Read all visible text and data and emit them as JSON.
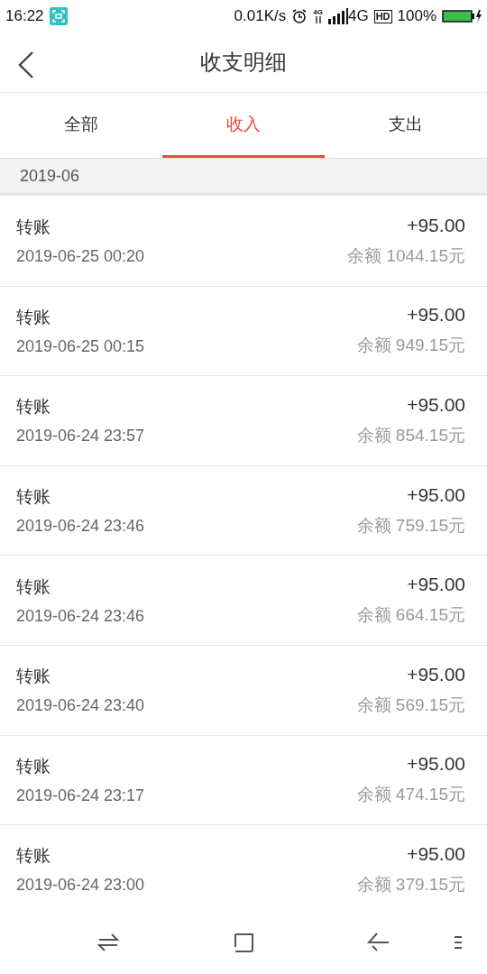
{
  "status_bar": {
    "time": "16:22",
    "network_speed": "0.01K/s",
    "data_label": "4G",
    "network": "4G",
    "hd": "HD",
    "battery": "100%"
  },
  "header": {
    "title": "收支明细"
  },
  "tabs": [
    {
      "label": "全部",
      "selected": false
    },
    {
      "label": "收入",
      "selected": true
    },
    {
      "label": "支出",
      "selected": false
    }
  ],
  "section": {
    "label": "2019-06"
  },
  "rows": [
    {
      "title": "转账",
      "time": "2019-06-25 00:20",
      "amount": "+95.00",
      "balance": "余额 1044.15元"
    },
    {
      "title": "转账",
      "time": "2019-06-25 00:15",
      "amount": "+95.00",
      "balance": "余额 949.15元"
    },
    {
      "title": "转账",
      "time": "2019-06-24 23:57",
      "amount": "+95.00",
      "balance": "余额 854.15元"
    },
    {
      "title": "转账",
      "time": "2019-06-24 23:46",
      "amount": "+95.00",
      "balance": "余额 759.15元"
    },
    {
      "title": "转账",
      "time": "2019-06-24 23:46",
      "amount": "+95.00",
      "balance": "余额 664.15元"
    },
    {
      "title": "转账",
      "time": "2019-06-24 23:40",
      "amount": "+95.00",
      "balance": "余额 569.15元"
    },
    {
      "title": "转账",
      "time": "2019-06-24 23:17",
      "amount": "+95.00",
      "balance": "余额 474.15元"
    },
    {
      "title": "转账",
      "time": "2019-06-24 23:00",
      "amount": "+95.00",
      "balance": "余额 379.15元"
    }
  ]
}
